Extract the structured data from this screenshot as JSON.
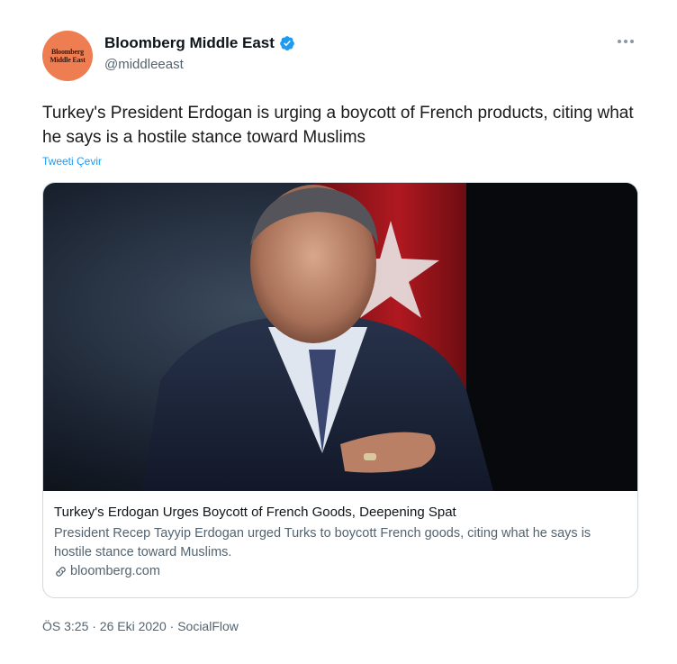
{
  "author": {
    "display_name": "Bloomberg Middle East",
    "handle": "@middleeast",
    "avatar_text_line1": "Bloomberg",
    "avatar_text_line2": "Middle East",
    "verified_icon": "verified-badge-icon",
    "accent": "#1d9bf0"
  },
  "tweet": {
    "text": "Turkey's President Erdogan is urging a boycott of French products, citing what he says is a hostile stance toward Muslims",
    "translate_label": "Tweeti Çevir"
  },
  "card": {
    "title": "Turkey's Erdogan Urges Boycott of French Goods, Deepening Spat",
    "description": "President Recep Tayyip Erdogan urged Turks to boycott French goods, citing what he says is hostile stance toward Muslims.",
    "domain": "bloomberg.com",
    "domain_icon": "link-icon"
  },
  "meta": {
    "timestamp": "ÖS 3:25 · 26 Eki 2020 · SocialFlow"
  },
  "colors": {
    "avatar_bg": "#ee7d51",
    "text_secondary": "#536471",
    "border": "#cfd9de"
  }
}
